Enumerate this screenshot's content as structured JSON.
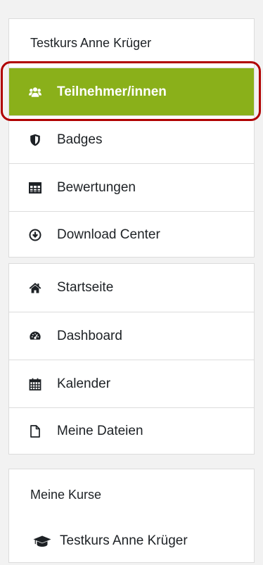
{
  "course_nav": {
    "course_title": "Testkurs Anne Krüger",
    "items": [
      {
        "label": "Teilnehmer/innen",
        "icon": "users-icon",
        "active": true
      },
      {
        "label": "Badges",
        "icon": "shield-icon"
      },
      {
        "label": "Bewertungen",
        "icon": "table-icon"
      },
      {
        "label": "Download Center",
        "icon": "download-circle-icon"
      }
    ]
  },
  "site_nav": {
    "items": [
      {
        "label": "Startseite",
        "icon": "home-icon"
      },
      {
        "label": "Dashboard",
        "icon": "dashboard-gauge-icon"
      },
      {
        "label": "Kalender",
        "icon": "calendar-icon"
      },
      {
        "label": "Meine Dateien",
        "icon": "file-icon"
      }
    ]
  },
  "my_courses": {
    "heading": "Meine Kurse",
    "items": [
      {
        "label": "Testkurs Anne Krüger",
        "icon": "graduation-cap-icon"
      }
    ]
  },
  "colors": {
    "active_background": "#8ab01a",
    "active_text": "#ffffff",
    "highlight_border": "#b00000",
    "text": "#1d2125",
    "divider": "#dcdcdc"
  }
}
